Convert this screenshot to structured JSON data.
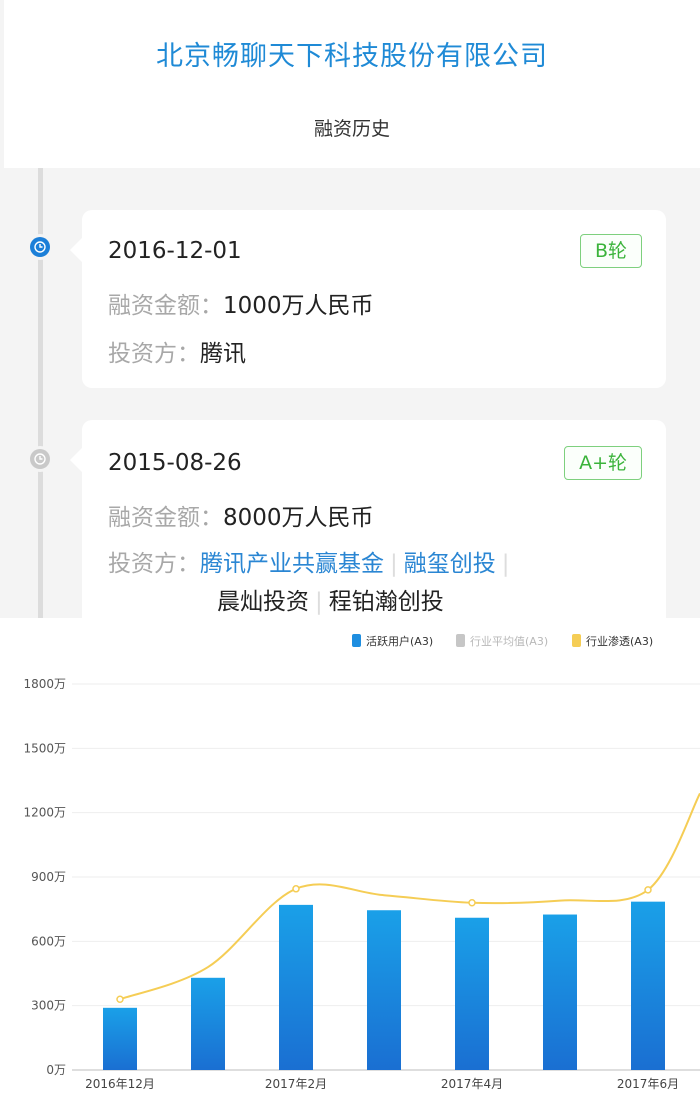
{
  "company": {
    "name": "北京畅聊天下科技股份有限公司"
  },
  "section_title": "融资历史",
  "rounds": [
    {
      "date": "2016-12-01",
      "round": "B轮",
      "amount_label": "融资金额：",
      "amount": "1000万人民币",
      "investors_label": "投资方：",
      "investors": [
        "腾讯"
      ]
    },
    {
      "date": "2015-08-26",
      "round": "A+轮",
      "amount_label": "融资金额：",
      "amount": "8000万人民币",
      "investors_label": "投资方：",
      "investors_linked": [
        "腾讯产业共赢基金",
        "融玺创投"
      ],
      "investors_plain": [
        "晨灿投资",
        "程铂瀚创投"
      ]
    }
  ],
  "colors": {
    "accent": "#1f8ad6",
    "badge_green": "#3bb33b",
    "bar_blue": "#1e8ee0",
    "line_yellow": "#f5cd55",
    "legend_gray": "#c6c6c6"
  },
  "icons": [
    "clock-icon"
  ],
  "chart_data": {
    "type": "bar",
    "title": "",
    "xlabel": "",
    "ylabel": "",
    "ylim": [
      0,
      1800
    ],
    "yticks": [
      "0万",
      "300万",
      "600万",
      "900万",
      "1200万",
      "1500万",
      "1800万"
    ],
    "xtick_labels": [
      {
        "index": 0,
        "label": "2016年12月"
      },
      {
        "index": 2,
        "label": "2017年2月"
      },
      {
        "index": 4,
        "label": "2017年4月"
      },
      {
        "index": 6,
        "label": "2017年6月"
      }
    ],
    "categories": [
      "2016-12",
      "2017-01",
      "2017-02",
      "2017-03",
      "2017-04",
      "2017-05",
      "2017-06",
      "2017-07"
    ],
    "series": [
      {
        "name": "活跃用户(A3)",
        "type": "bar",
        "values": [
          290,
          430,
          770,
          745,
          710,
          725,
          785,
          null
        ]
      },
      {
        "name": "行业平均值(A3)",
        "type": "none",
        "values": []
      },
      {
        "name": "行业渗透(A3)",
        "type": "line",
        "values": [
          330,
          480,
          845,
          815,
          780,
          790,
          840,
          1290
        ]
      }
    ],
    "legend": "top-right",
    "grid": true
  }
}
